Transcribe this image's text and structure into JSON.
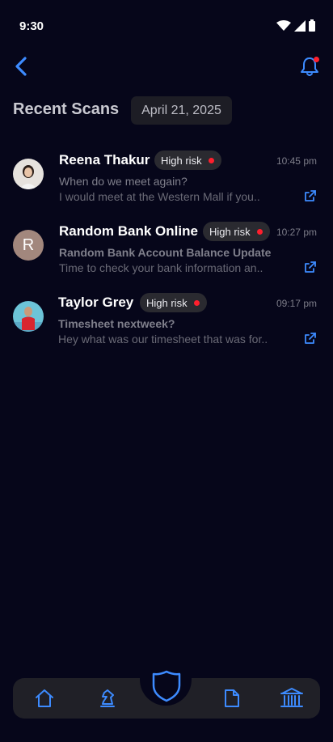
{
  "status_bar": {
    "time": "9:30"
  },
  "header": {
    "back_icon": "chevron-left-icon",
    "notification_icon": "bell-icon"
  },
  "page": {
    "title": "Recent Scans",
    "date": "April 21,  2025"
  },
  "scans": [
    {
      "name": "Reena Thakur",
      "badge": "High risk",
      "time": "10:45 pm",
      "subject": "When do we meet again?",
      "preview": "I would meet at the Western Mall if you..",
      "avatar": "photo"
    },
    {
      "name": "Random Bank Online",
      "badge": "High risk",
      "time": "10:27 pm",
      "subject": "Random Bank Account Balance Update",
      "preview": "Time to check your bank information an..",
      "avatar_letter": "R"
    },
    {
      "name": "Taylor Grey",
      "badge": "High risk",
      "time": "09:17 pm",
      "subject": "Timesheet nextweek?",
      "preview": "Hey what was our timesheet that was for..",
      "avatar": "photo"
    }
  ],
  "bottom_nav": {
    "items": [
      "home-icon",
      "chess-knight-icon",
      "shield-icon",
      "document-icon",
      "bank-icon"
    ]
  },
  "colors": {
    "accent": "#3d8bff",
    "risk": "#ff1f2d",
    "background": "#06061a"
  }
}
